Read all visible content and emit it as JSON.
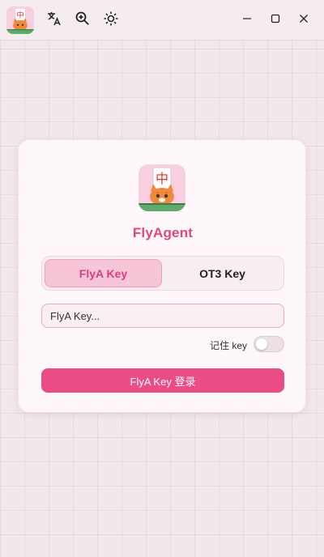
{
  "titlebar": {
    "app_icon": "cat-mahjong-logo",
    "tools": [
      {
        "name": "translate-icon"
      },
      {
        "name": "zoom-in-icon"
      },
      {
        "name": "brightness-icon"
      }
    ],
    "window_controls": [
      "minimize-icon",
      "maximize-icon",
      "close-icon"
    ]
  },
  "card": {
    "logo_text": "中",
    "title": "FlyAgent",
    "tabs": [
      {
        "label": "FlyA Key",
        "active": true
      },
      {
        "label": "OT3 Key",
        "active": false
      }
    ],
    "input": {
      "placeholder": "FlyA Key..."
    },
    "remember_label": "记住 key",
    "remember_on": false,
    "login_label": "FlyA Key 登录"
  },
  "colors": {
    "accent": "#eb4c86",
    "title": "#e0477e",
    "tab_active_bg": "#f6c6d8",
    "background": "#f2e8ec"
  }
}
